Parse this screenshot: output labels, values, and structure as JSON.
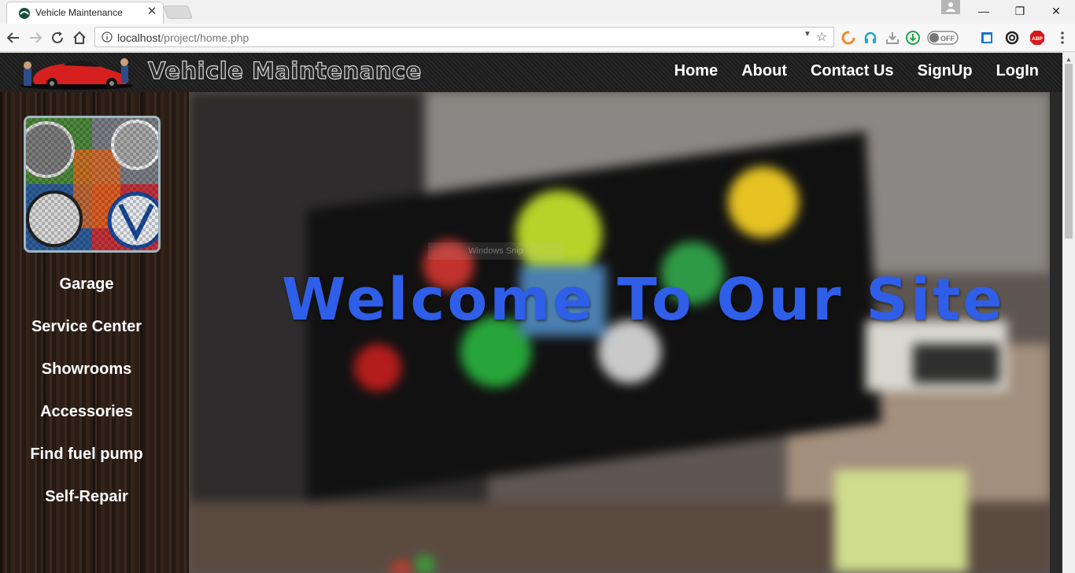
{
  "browser": {
    "tab_title": "Vehicle Maintenance",
    "url_host": "localhost",
    "url_path": "/project/home.php",
    "extensions": {
      "abp_label": "ABP",
      "toggle_label": "OFF"
    }
  },
  "site": {
    "brand": "Vehicle Maintenance",
    "nav": [
      "Home",
      "About",
      "Contact Us",
      "SignUp",
      "LogIn"
    ],
    "sidebar": [
      "Garage",
      "Service Center",
      "Showrooms",
      "Accessories",
      "Find fuel pump",
      "Self-Repair"
    ],
    "hero_title": "Welcome To Our Site",
    "ghost_text": "Windows Snip"
  },
  "colors": {
    "hero_title": "#2f5ee8",
    "header_bg": "#1f1f1f",
    "nav_text": "#ffffff"
  }
}
